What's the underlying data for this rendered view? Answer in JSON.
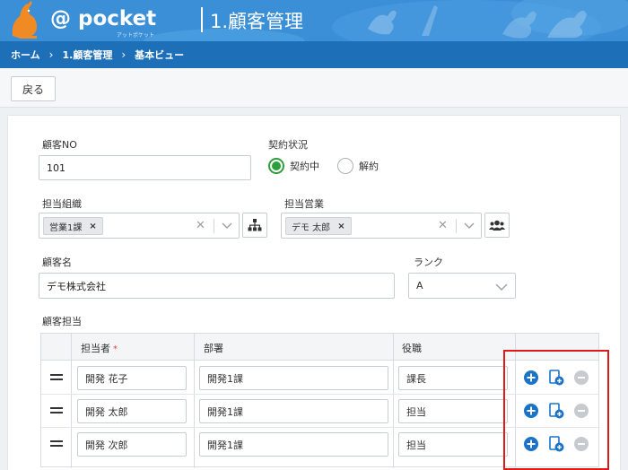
{
  "header": {
    "logo": "@ pocket",
    "logo_sub": "アットポケット",
    "app_title": "1.顧客管理"
  },
  "breadcrumb": [
    "ホーム",
    "1.顧客管理",
    "基本ビュー"
  ],
  "breadcrumb_sep": "›",
  "toolbar": {
    "back_label": "戻る"
  },
  "form": {
    "customer_no": {
      "label": "顧客NO",
      "value": "101"
    },
    "contract": {
      "label": "契約状況",
      "options": [
        "契約中",
        "解約"
      ],
      "selected": "契約中"
    },
    "org": {
      "label": "担当組織",
      "chip": "営業1課"
    },
    "sales": {
      "label": "担当営業",
      "chip": "デモ 太郎"
    },
    "customer_name": {
      "label": "顧客名",
      "value": "デモ株式会社"
    },
    "rank": {
      "label": "ランク",
      "value": "A"
    },
    "contacts_label": "顧客担当"
  },
  "table": {
    "headers": [
      "担当者",
      "部署",
      "役職"
    ],
    "required_mark": "*",
    "rows": [
      {
        "person": "開発 花子",
        "dept": "開発1課",
        "title": "課長"
      },
      {
        "person": "開発 太郎",
        "dept": "開発1課",
        "title": "担当"
      },
      {
        "person": "開発 次郎",
        "dept": "開発1課",
        "title": "担当"
      }
    ]
  },
  "colors": {
    "header": "#3a8fd6",
    "breadcrumb": "#1d6fb8",
    "radio": "#2e9e3d",
    "add": "#1a73c9",
    "highlight": "#e0191b"
  },
  "icons": [
    "org-chart-icon",
    "users-icon",
    "add-row-icon",
    "copy-row-icon",
    "remove-row-icon",
    "drag-handle-icon"
  ]
}
